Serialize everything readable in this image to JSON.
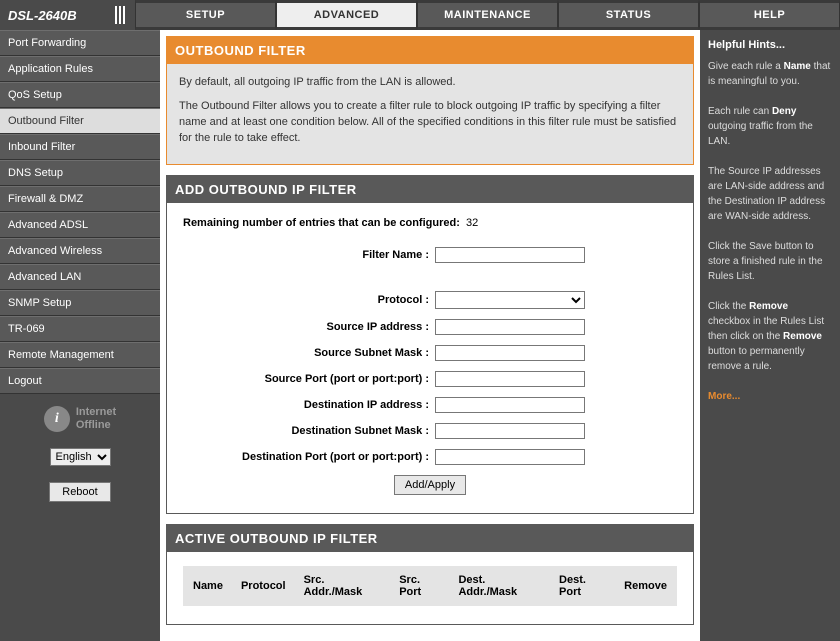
{
  "logo": "DSL-2640B",
  "tabs": [
    "SETUP",
    "ADVANCED",
    "MAINTENANCE",
    "STATUS",
    "HELP"
  ],
  "active_tab": 1,
  "sidebar": {
    "items": [
      "Port Forwarding",
      "Application Rules",
      "QoS Setup",
      "Outbound Filter",
      "Inbound Filter",
      "DNS Setup",
      "Firewall & DMZ",
      "Advanced ADSL",
      "Advanced Wireless",
      "Advanced LAN",
      "SNMP Setup",
      "TR-069",
      "Remote Management",
      "Logout"
    ],
    "active": 3,
    "internet": {
      "line1": "Internet",
      "line2": "Offline"
    },
    "language": "English",
    "reboot": "Reboot"
  },
  "outbound": {
    "title": "OUTBOUND FILTER",
    "p1": "By default, all outgoing IP traffic from the LAN is allowed.",
    "p2": "The Outbound Filter allows you to create a filter rule to block outgoing IP traffic by specifying a filter name and at least one condition below. All of the specified conditions in this filter rule must be satisfied for the rule to take effect."
  },
  "add": {
    "title": "ADD OUTBOUND IP FILTER",
    "remain_label": "Remaining number of entries that can be configured:",
    "remain_value": "32",
    "labels": {
      "filter_name": "Filter Name :",
      "protocol": "Protocol :",
      "src_ip": "Source IP address :",
      "src_mask": "Source Subnet Mask :",
      "src_port": "Source Port (port or port:port) :",
      "dst_ip": "Destination IP address :",
      "dst_mask": "Destination Subnet Mask :",
      "dst_port": "Destination Port (port or port:port) :"
    },
    "values": {
      "filter_name": "",
      "protocol": "",
      "src_ip": "",
      "src_mask": "",
      "src_port": "",
      "dst_ip": "",
      "dst_mask": "",
      "dst_port": ""
    },
    "apply": "Add/Apply"
  },
  "active_filter": {
    "title": "ACTIVE OUTBOUND IP FILTER",
    "cols": [
      "Name",
      "Protocol",
      "Src. Addr./Mask",
      "Src. Port",
      "Dest. Addr./Mask",
      "Dest. Port",
      "Remove"
    ]
  },
  "hints": {
    "title": "Helpful Hints...",
    "p1a": "Give each rule a ",
    "p1b": "Name",
    "p1c": " that is meaningful to you.",
    "p2a": "Each rule can ",
    "p2b": "Deny",
    "p2c": " outgoing traffic from the LAN.",
    "p3": "The Source IP addresses are LAN-side address and the Destination IP address are WAN-side address.",
    "p4": "Click the Save button to store a finished rule in the Rules List.",
    "p5a": "Click the ",
    "p5b": "Remove",
    "p5c": " checkbox in the Rules List then click on the ",
    "p5d": "Remove",
    "p5e": " button to permanently remove a rule.",
    "more": "More..."
  }
}
